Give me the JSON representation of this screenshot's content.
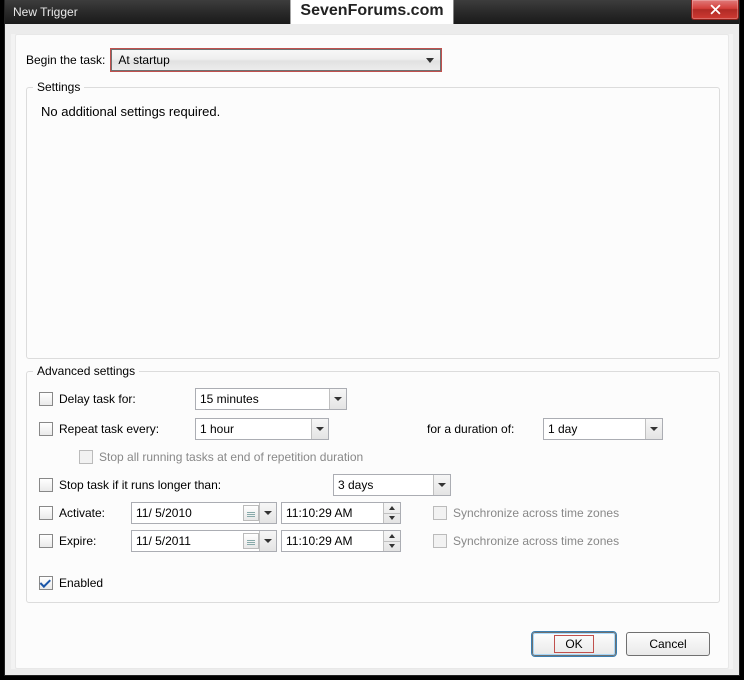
{
  "title": "New Trigger",
  "watermark": "SevenForums.com",
  "begin": {
    "label": "Begin the task:",
    "value": "At startup"
  },
  "settings": {
    "label": "Settings",
    "text": "No additional settings required."
  },
  "advanced": {
    "label": "Advanced settings",
    "delay": {
      "label": "Delay task for:",
      "value": "15 minutes"
    },
    "repeat": {
      "label": "Repeat task every:",
      "value": "1 hour",
      "duration_label": "for a duration of:",
      "duration_value": "1 day"
    },
    "stop_repetition": "Stop all running tasks at end of repetition duration",
    "stop_longer": {
      "label": "Stop task if it runs longer than:",
      "value": "3 days"
    },
    "activate": {
      "label": "Activate:",
      "date": "11/  5/2010",
      "time": "11:10:29 AM",
      "sync": "Synchronize across time zones"
    },
    "expire": {
      "label": "Expire:",
      "date": "11/  5/2011",
      "time": "11:10:29 AM",
      "sync": "Synchronize across time zones"
    },
    "enabled": "Enabled"
  },
  "footer": {
    "ok": "OK",
    "cancel": "Cancel"
  }
}
